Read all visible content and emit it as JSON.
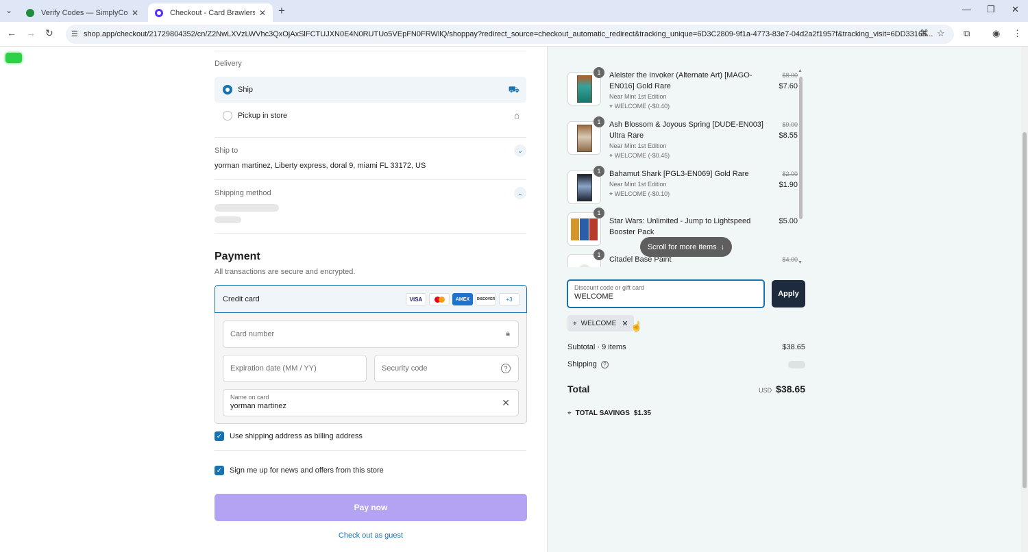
{
  "browser": {
    "tabs": [
      {
        "title": "Verify Codes — SimplyCodes"
      },
      {
        "title": "Checkout - Card Brawlers"
      }
    ],
    "url": "shop.app/checkout/21729804352/cn/Z2NwLXVzLWVhc3QxOjAxSlFCTUJXN0E4N0RUTUo5VEpFN0FRWllQ/shoppay?redirect_source=checkout_automatic_redirect&tracking_unique=6D3C2809-9f1a-4773-83e7-04d2a2f1957f&tracking_visit=6DD33165..."
  },
  "delivery": {
    "label": "Delivery",
    "ship": "Ship",
    "pickup": "Pickup in store"
  },
  "ship_to": {
    "label": "Ship to",
    "address": "yorman martinez, Liberty express, doral 9, miami FL 33172, US"
  },
  "shipping_method": {
    "label": "Shipping method"
  },
  "payment": {
    "title": "Payment",
    "subtitle": "All transactions are secure and encrypted.",
    "credit_card": "Credit card",
    "brands": [
      "VISA",
      "",
      "AMEX",
      "DISCOVER",
      "+3"
    ],
    "card_number_placeholder": "Card number",
    "expiration_placeholder": "Expiration date (MM / YY)",
    "security_placeholder": "Security code",
    "name_label": "Name on card",
    "name_value": "yorman martinez",
    "billing_same": "Use shipping address as billing address",
    "newsletter": "Sign me up for news and offers from this store",
    "pay_now": "Pay now",
    "guest": "Check out as guest"
  },
  "items": [
    {
      "qty": "1",
      "name": "Aleister the Invoker (Alternate Art) [MAGO-EN016] Gold Rare",
      "variant": "Near Mint 1st Edition",
      "discount": "WELCOME (-$0.40)",
      "old_price": "$8.00",
      "price": "$7.60"
    },
    {
      "qty": "1",
      "name": "Ash Blossom & Joyous Spring [DUDE-EN003] Ultra Rare",
      "variant": "Near Mint 1st Edition",
      "discount": "WELCOME (-$0.45)",
      "old_price": "$9.00",
      "price": "$8.55"
    },
    {
      "qty": "1",
      "name": "Bahamut Shark [PGL3-EN069] Gold Rare",
      "variant": "Near Mint 1st Edition",
      "discount": "WELCOME (-$0.10)",
      "old_price": "$2.00",
      "price": "$1.90"
    },
    {
      "qty": "1",
      "name": "Star Wars: Unlimited - Jump to Lightspeed Booster Pack",
      "variant": "",
      "discount": "",
      "old_price": "",
      "price": "$5.00"
    },
    {
      "qty": "1",
      "name": "Citadel Base Paint",
      "variant": "",
      "discount": "",
      "old_price": "$4.00",
      "price": ""
    }
  ],
  "scroll_hint": "Scroll for more items",
  "discount": {
    "label": "Discount code or gift card",
    "value": "WELCOME",
    "apply": "Apply",
    "tag": "WELCOME"
  },
  "summary": {
    "subtotal_label": "Subtotal · 9 items",
    "subtotal": "$38.65",
    "shipping_label": "Shipping",
    "total_label": "Total",
    "currency": "USD",
    "total": "$38.65",
    "savings_label": "TOTAL SAVINGS",
    "savings": "$1.35"
  }
}
